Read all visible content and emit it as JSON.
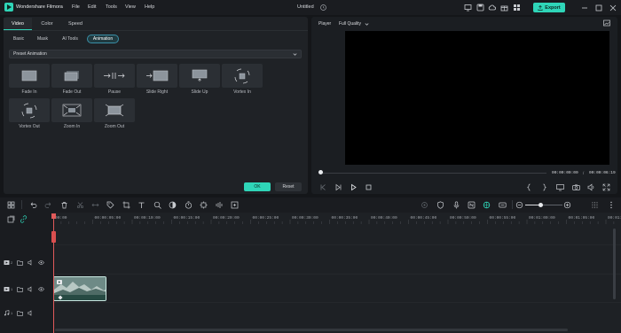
{
  "app": {
    "name": "Wondershare Filmora",
    "menu": [
      "File",
      "Edit",
      "Tools",
      "View",
      "Help"
    ],
    "project_title": "Untitled",
    "export_label": "Export"
  },
  "left_panel": {
    "tabs": [
      "Video",
      "Color",
      "Speed"
    ],
    "active_tab": "Video",
    "subtabs": [
      "Basic",
      "Mask",
      "AI Tools",
      "Animation"
    ],
    "active_subtab": "Animation",
    "preset_label": "Preset Animation",
    "presets": [
      "Fade In",
      "Fade Out",
      "Pause",
      "Slide Right",
      "Slide Up",
      "Vortex In",
      "Vortex Out",
      "Zoom In",
      "Zoom Out"
    ],
    "ok_label": "OK",
    "reset_label": "Reset"
  },
  "player": {
    "label": "Player",
    "quality": "Full Quality",
    "current_time": "00:00:00:00",
    "separator": "/",
    "total_time": "00:00:06:19",
    "progress": 0
  },
  "timeline": {
    "ruler_labels": [
      "00:00",
      "00:00:05:00",
      "00:00:10:00",
      "00:00:15:00",
      "00:00:20:00",
      "00:00:25:00",
      "00:00:30:00",
      "00:00:35:00",
      "00:00:40:00",
      "00:00:45:00",
      "00:00:50:00",
      "00:00:55:00",
      "00:01:00:00",
      "00:01:05:00",
      "00:01:10:00"
    ],
    "tracks": [
      {
        "type": "video",
        "number": "2"
      },
      {
        "type": "video",
        "number": "1"
      },
      {
        "type": "audio",
        "number": "1"
      }
    ]
  },
  "colors": {
    "accent": "#2fd5b8",
    "playhead": "#e05a5a",
    "active_subtab_border": "#3a8fa7"
  }
}
